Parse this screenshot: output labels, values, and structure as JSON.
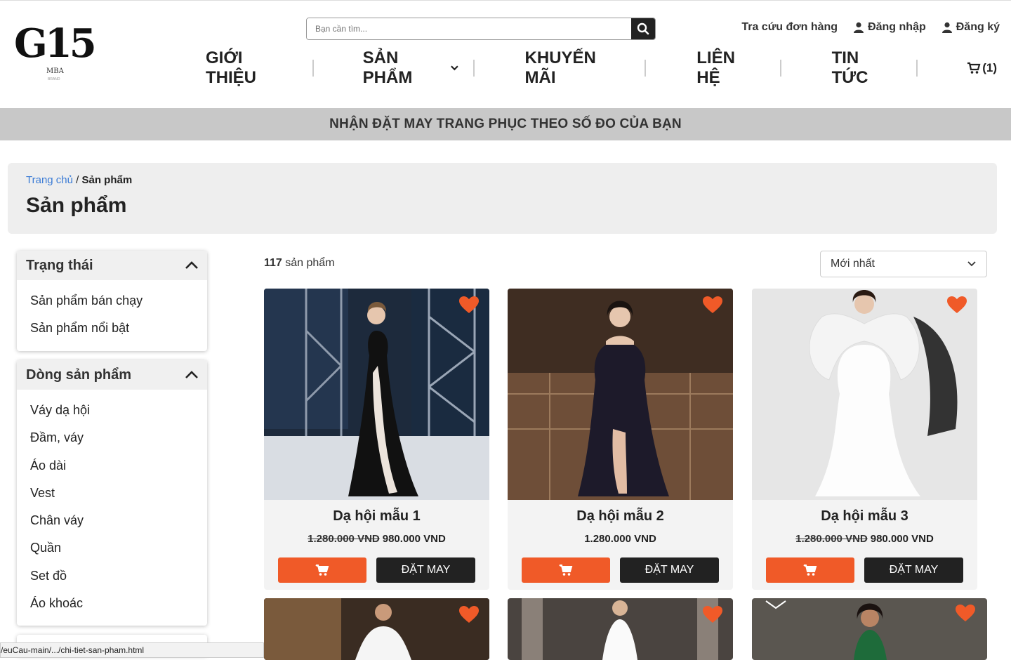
{
  "header": {
    "logo_text": "G15",
    "logo_sub": "MBA",
    "logo_sub2": "BRAND",
    "search_placeholder": "Bạn cần tìm...",
    "top_links": {
      "track_order": "Tra cứu đơn hàng",
      "login": "Đăng nhập",
      "register": "Đăng ký"
    },
    "nav": {
      "about": "GIỚI THIỆU",
      "products": "SẢN PHẨM",
      "promotions": "KHUYẾN MÃI",
      "contact": "LIÊN HỆ",
      "news": "TIN TỨC",
      "cart_count": "(1)"
    }
  },
  "banner": "NHẬN ĐẶT MAY TRANG PHỤC THEO SỐ ĐO CỦA BẠN",
  "breadcrumb": {
    "home": "Trang chủ",
    "separator": " / ",
    "current": "Sản phẩm"
  },
  "page_title": "Sản phẩm",
  "sidebar": {
    "status": {
      "title": "Trạng thái",
      "items": [
        "Sản phẩm bán chạy",
        "Sản phẩm nổi bật"
      ]
    },
    "lines": {
      "title": "Dòng sản phẩm",
      "items": [
        "Váy dạ hội",
        "Đầm, váy",
        "Áo dài",
        "Vest",
        "Chân váy",
        "Quần",
        "Set đồ",
        "Áo khoác"
      ]
    }
  },
  "listing": {
    "count_number": "117",
    "count_label": " sản phẩm",
    "sort_selected": "Mới nhất"
  },
  "products": [
    {
      "name": "Dạ hội mẫu 1",
      "old_price": "1.280.000 VND",
      "price": "980.000 VND",
      "order_label": "ĐẶT MAY"
    },
    {
      "name": "Dạ hội mẫu 2",
      "old_price": "",
      "price": "1.280.000 VND",
      "order_label": "ĐẶT MAY"
    },
    {
      "name": "Dạ hội mẫu 3",
      "old_price": "1.280.000 VND",
      "price": "980.000 VND",
      "order_label": "ĐẶT MAY"
    }
  ],
  "status_url": "/euCau-main/.../chi-tiet-san-pham.html",
  "colors": {
    "accent": "#f05a28",
    "dark_button": "#222222",
    "banner_bg": "#c8c8c8",
    "link": "#3a7bd5"
  }
}
